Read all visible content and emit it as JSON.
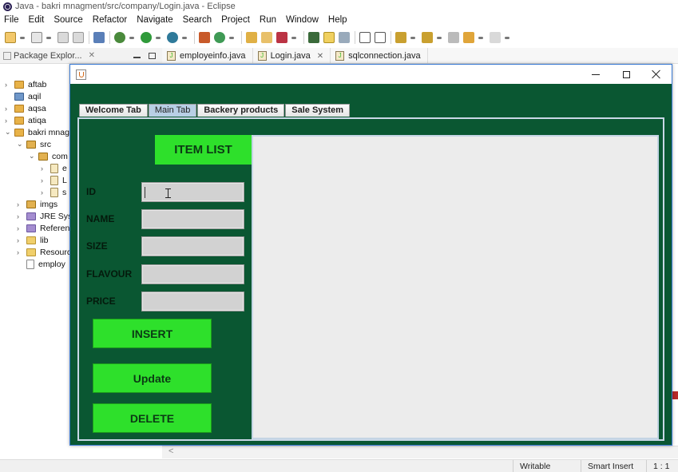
{
  "eclipse": {
    "window_title": "Java - bakri mnagment/src/company/Login.java - Eclipse",
    "menu": [
      "File",
      "Edit",
      "Source",
      "Refactor",
      "Navigate",
      "Search",
      "Project",
      "Run",
      "Window",
      "Help"
    ],
    "explorer_tab": "Package Explor...",
    "editor_tabs": [
      "employeinfo.java",
      "Login.java",
      "sqlconnection.java"
    ],
    "tree": [
      "aftab",
      "aqil",
      "aqsa",
      "atiqa",
      "bakri mnag",
      "src",
      "com",
      "e",
      "L",
      "s",
      "imgs",
      "JRE Syst",
      "Referen",
      "lib",
      "Resourc",
      "employ"
    ],
    "status": {
      "writable": "Writable",
      "insert_mode": "Smart Insert",
      "position": "1 : 1"
    },
    "scroll_arrow": "<"
  },
  "app": {
    "tabs": [
      "Welcome Tab",
      "Main Tab",
      "Backery products",
      "Sale System"
    ],
    "active_tab": "Main Tab",
    "header": "ITEM LIST",
    "fields": {
      "id": {
        "label": "ID",
        "value": ""
      },
      "name": {
        "label": "NAME",
        "value": ""
      },
      "size": {
        "label": "SIZE",
        "value": ""
      },
      "flavour": {
        "label": "FLAVOUR",
        "value": ""
      },
      "price": {
        "label": "PRICE",
        "value": ""
      }
    },
    "buttons": {
      "insert": "INSERT",
      "update": "Update",
      "delete": "DELETE"
    },
    "colors": {
      "background": "#0a5732",
      "button": "#2ee02b",
      "field": "#d2d2d2",
      "table_area": "#ececec"
    }
  }
}
